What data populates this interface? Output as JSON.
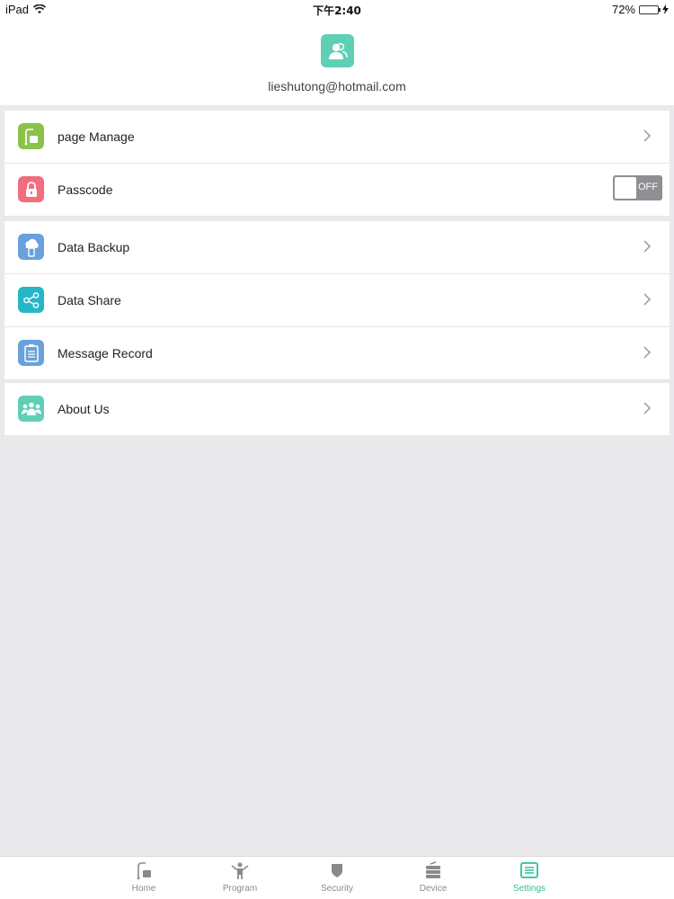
{
  "status_bar": {
    "device": "iPad",
    "time": "下午2:40",
    "battery": "72%",
    "battery_level": 0.72
  },
  "profile": {
    "email": "lieshutong@hotmail.com"
  },
  "groups": [
    {
      "items": [
        {
          "label": "page Manage",
          "icon": "page-manage-icon",
          "color": "#8bc34a"
        },
        {
          "label": "Passcode",
          "icon": "lock-icon",
          "color": "#f26d7d",
          "toggle": "OFF"
        }
      ]
    },
    {
      "items": [
        {
          "label": "Data Backup",
          "icon": "cloud-backup-icon",
          "color": "#6aa0dc"
        },
        {
          "label": "Data Share",
          "icon": "share-icon",
          "color": "#25b7c8"
        },
        {
          "label": "Message Record",
          "icon": "clipboard-icon",
          "color": "#6aa0dc"
        }
      ]
    },
    {
      "items": [
        {
          "label": "About Us",
          "icon": "people-icon",
          "color": "#5fcfb6"
        }
      ]
    }
  ],
  "tab_bar": {
    "tabs": [
      {
        "label": "Home",
        "icon": "home-icon"
      },
      {
        "label": "Program",
        "icon": "program-icon"
      },
      {
        "label": "Security",
        "icon": "shield-icon"
      },
      {
        "label": "Device",
        "icon": "device-icon"
      },
      {
        "label": "Settings",
        "icon": "settings-icon",
        "active": true
      }
    ],
    "active_color": "#2fbf9a"
  }
}
